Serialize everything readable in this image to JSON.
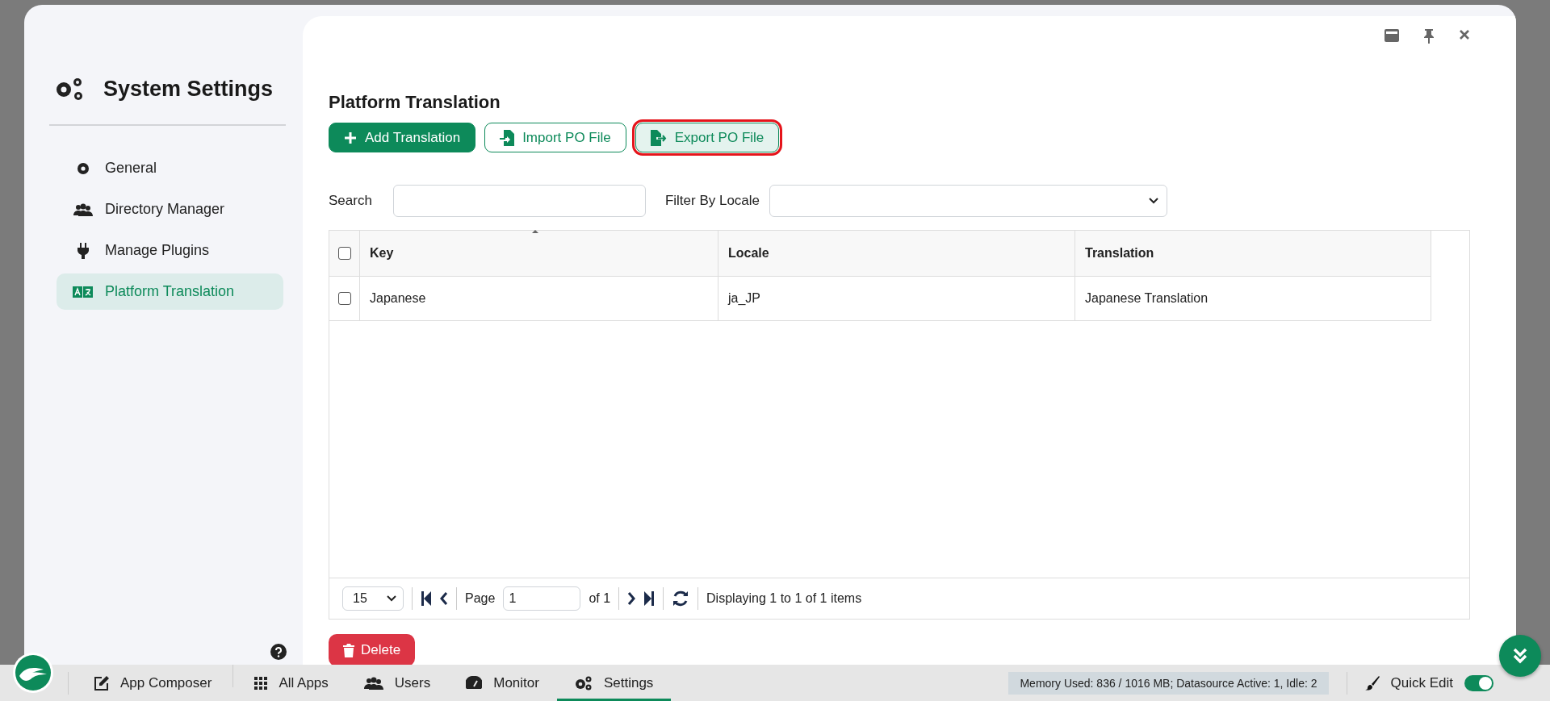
{
  "sidebar": {
    "title": "System Settings",
    "items": [
      {
        "label": "General",
        "selected": false
      },
      {
        "label": "Directory Manager",
        "selected": false
      },
      {
        "label": "Manage Plugins",
        "selected": false
      },
      {
        "label": "Platform Translation",
        "selected": true
      }
    ]
  },
  "page": {
    "title": "Platform Translation",
    "buttons": [
      {
        "label": "Add Translation",
        "kind": "primary",
        "highlighted": false
      },
      {
        "label": "Import PO File",
        "kind": "outline",
        "highlighted": false
      },
      {
        "label": "Export PO File",
        "kind": "outline",
        "highlighted": true
      }
    ],
    "search_label": "Search",
    "locale_label": "Filter By Locale",
    "table": {
      "all_checked": false,
      "columns": [
        "Key",
        "Locale",
        "Translation"
      ],
      "rows": [
        {
          "checked": false,
          "cells": [
            "Japanese",
            "ja_JP",
            "Japanese Translation"
          ]
        }
      ]
    },
    "pagination": {
      "page_size": "15",
      "page_label": "Page",
      "page": "1",
      "of": "of 1",
      "status": "Displaying 1 to 1 of 1 items"
    },
    "delete_button": "Delete"
  },
  "taskbar": {
    "items": [
      {
        "label": "App Composer",
        "selected": false
      },
      {
        "label": "All Apps",
        "selected": false
      },
      {
        "label": "Users",
        "selected": false
      },
      {
        "label": "Monitor",
        "selected": false
      },
      {
        "label": "Settings",
        "selected": true
      }
    ],
    "memory": "Memory Used: 836 / 1016 MB; Datasource Active: 1, Idle: 2",
    "quick_edit": {
      "label": "Quick Edit",
      "on": true
    }
  }
}
